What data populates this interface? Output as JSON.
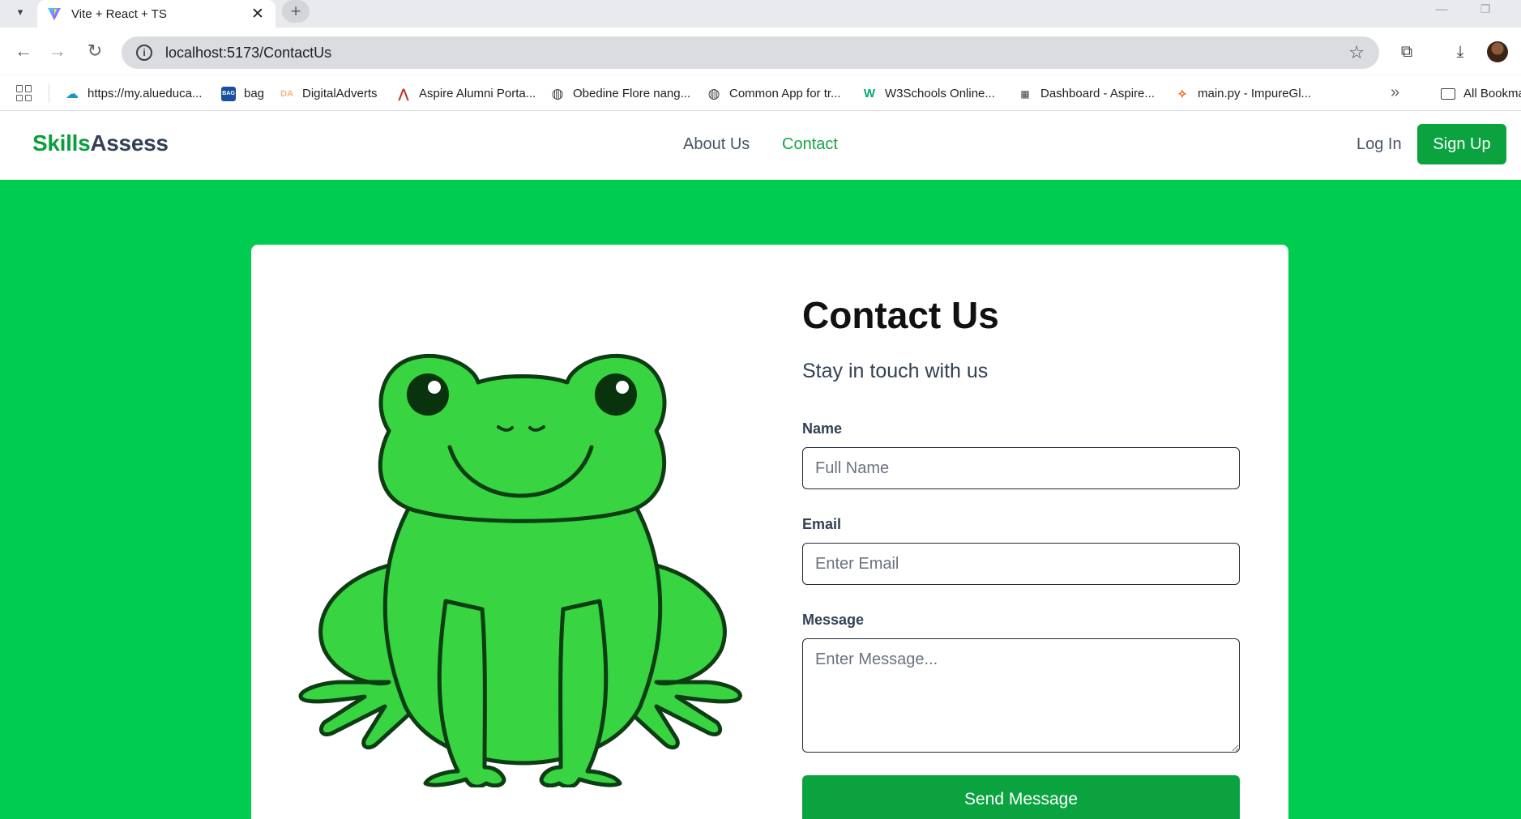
{
  "browser": {
    "tab_title": "Vite + React + TS",
    "tab_close": "✕",
    "new_tab": "+",
    "url": "localhost:5173/ContactUs",
    "bookmarks": [
      {
        "label": "https://my.alueduca...",
        "icon": "salesforce-cloud-icon",
        "color": "#1798c1"
      },
      {
        "label": "bag",
        "icon": "bag-icon",
        "color": "#1a4fa0"
      },
      {
        "label": "DigitalAdverts",
        "icon": "digitaladverts-icon",
        "color": "#f4b183"
      },
      {
        "label": "Aspire Alumni Porta...",
        "icon": "aspire-icon",
        "color": "#c0392b"
      },
      {
        "label": "Obedine Flore nang...",
        "icon": "globe-icon",
        "color": "#3c4043"
      },
      {
        "label": "Common App for tr...",
        "icon": "globe-icon",
        "color": "#3c4043"
      },
      {
        "label": "W3Schools Online...",
        "icon": "w3schools-icon",
        "color": "#04aa6d"
      },
      {
        "label": "Dashboard - Aspire...",
        "icon": "dashboard-icon",
        "color": "#3c4043"
      },
      {
        "label": "main.py - ImpureGl...",
        "icon": "replit-icon",
        "color": "#f26207"
      }
    ],
    "all_bookmarks": "All Bookma"
  },
  "header": {
    "logo_part_a": "Skills",
    "logo_part_b": "Assess",
    "nav": [
      {
        "label": "About Us"
      },
      {
        "label": "Contact"
      }
    ],
    "login": "Log In",
    "signup": "Sign Up"
  },
  "contact": {
    "title": "Contact Us",
    "subtitle": "Stay in touch with us",
    "name_label": "Name",
    "name_placeholder": "Full Name",
    "email_label": "Email",
    "email_placeholder": "Enter Email",
    "message_label": "Message",
    "message_placeholder": "Enter Message...",
    "send": "Send Message"
  },
  "colors": {
    "brand_green": "#0aa33f",
    "page_green": "#00cc50",
    "frog_green": "#38d442"
  }
}
